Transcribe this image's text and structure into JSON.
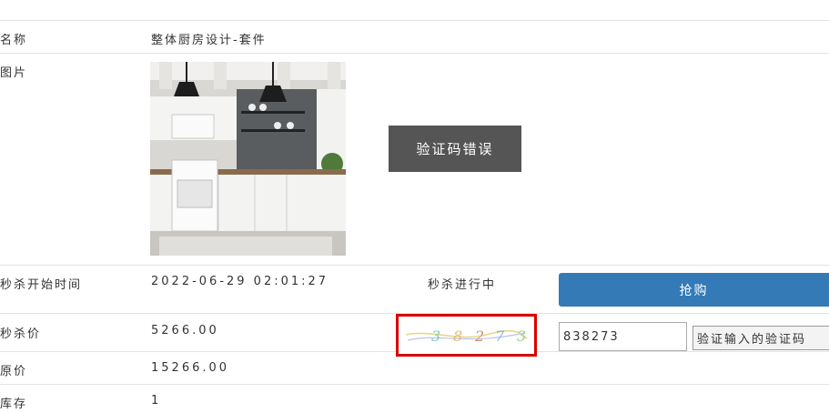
{
  "rows": {
    "name_label": "名称",
    "name_value": "整体厨房设计-套件",
    "image_label": "图片",
    "start_label": "秒杀开始时间",
    "start_value": "2022-06-29 02:01:27",
    "price_label": "秒杀价",
    "price_value": "5266.00",
    "orig_label": "原价",
    "orig_value": "15266.00",
    "stock_label": "库存",
    "stock_value": "1"
  },
  "toast": {
    "text": "验证码错误"
  },
  "seckill": {
    "status": "秒杀进行中",
    "buy_label": "抢购"
  },
  "captcha": {
    "digits": [
      "3",
      "8",
      "2",
      "7",
      "3"
    ],
    "digit_colors": [
      "#7fc8c0",
      "#e3b97a",
      "#d68a73",
      "#7fb3d8",
      "#9dcf8e"
    ]
  },
  "verify": {
    "input_value": "838273",
    "button_label": "验证输入的验证码"
  },
  "colors": {
    "primary": "#337ab7",
    "highlight": "#d90000",
    "toast_bg": "#555555"
  }
}
